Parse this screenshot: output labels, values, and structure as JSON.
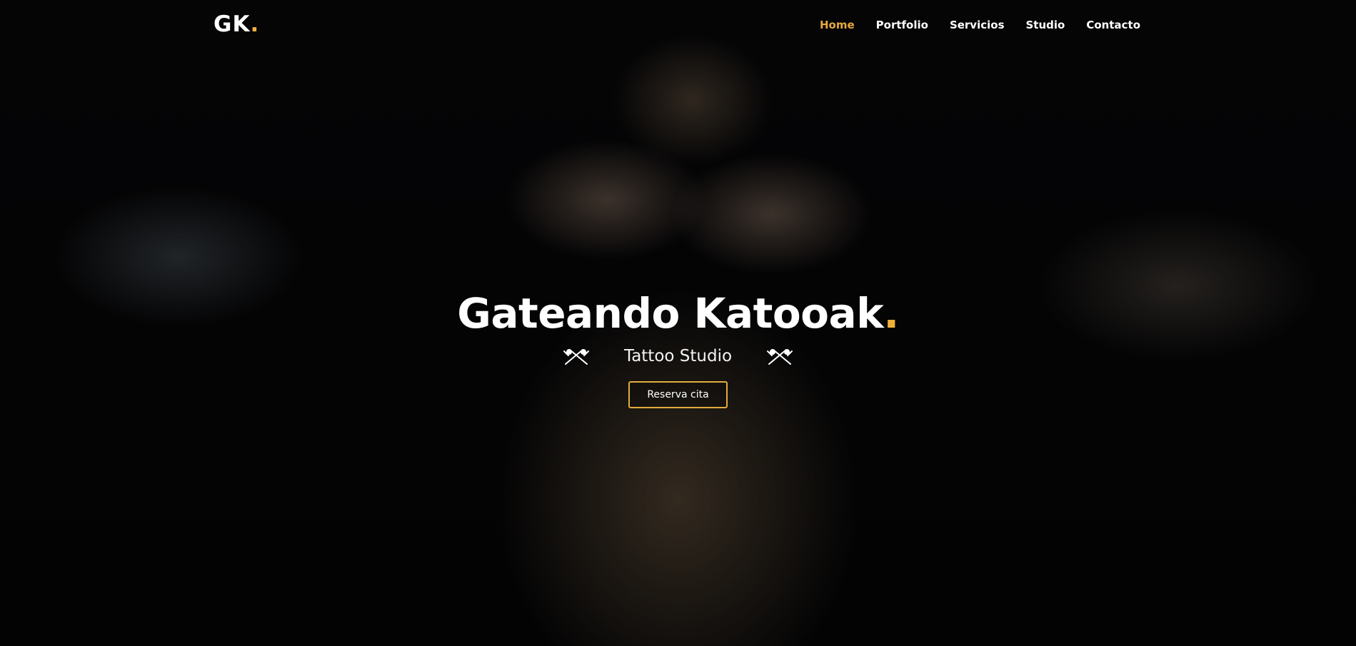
{
  "brand": {
    "logo_text": "GK",
    "logo_dot": ".",
    "accent_color": "#f0b13a"
  },
  "nav": {
    "items": [
      {
        "label": "Home",
        "active": true
      },
      {
        "label": "Portfolio",
        "active": false
      },
      {
        "label": "Servicios",
        "active": false
      },
      {
        "label": "Studio",
        "active": false
      },
      {
        "label": "Contacto",
        "active": false
      }
    ]
  },
  "hero": {
    "title": "Gateando Katooak",
    "title_dot": ".",
    "subtitle": "Tattoo Studio",
    "left_icon": "tattoo-machines-icon",
    "right_icon": "tattoo-machines-icon",
    "cta_label": "Reserva cita"
  },
  "colors": {
    "active_nav": "#e6a93d",
    "button_border": "#e2ad3b",
    "text": "#ffffff",
    "background": "#050505"
  }
}
